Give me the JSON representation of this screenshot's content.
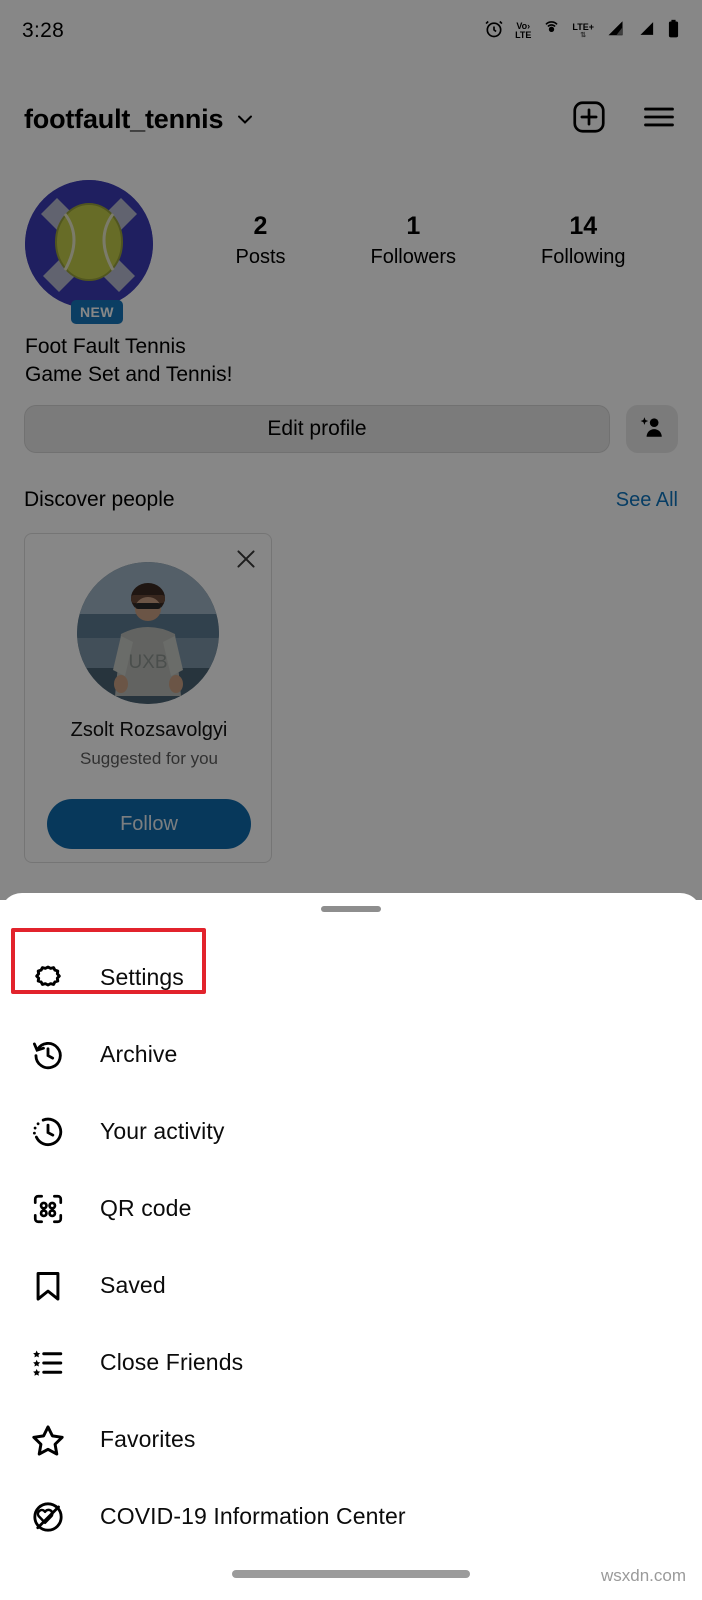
{
  "status_bar": {
    "time": "3:28",
    "icons": [
      {
        "name": "alarm-icon",
        "label": "alarm"
      },
      {
        "name": "volte-icon",
        "label": "VoLTE"
      },
      {
        "name": "hotspot-icon",
        "label": "hotspot"
      },
      {
        "name": "lte-plus-icon",
        "label": "LTE+"
      },
      {
        "name": "signal-sim1-icon",
        "label": "signal 1"
      },
      {
        "name": "signal-sim2-icon",
        "label": "signal 2"
      },
      {
        "name": "battery-icon",
        "label": "battery"
      }
    ]
  },
  "header": {
    "username": "footfault_tennis",
    "dropdown_icon": "chevron-down-icon",
    "create_icon": "plus-square-icon",
    "menu_icon": "hamburger-menu-icon"
  },
  "profile": {
    "avatar_badge": "NEW",
    "display_name": "Foot Fault Tennis",
    "bio": "Game Set and Tennis!",
    "stats": [
      {
        "value": "2",
        "label": "Posts"
      },
      {
        "value": "1",
        "label": "Followers"
      },
      {
        "value": "14",
        "label": "Following"
      }
    ],
    "edit_profile_label": "Edit profile",
    "add_person_icon": "add-person-icon"
  },
  "discover": {
    "title": "Discover people",
    "see_all_label": "See All",
    "suggestion": {
      "name": "Zsolt Rozsavolgyi",
      "subtitle": "Suggested for you",
      "follow_label": "Follow",
      "close_icon": "close-icon"
    }
  },
  "sheet": {
    "items": [
      {
        "label": "Settings",
        "icon": "gear-icon",
        "highlighted": true
      },
      {
        "label": "Archive",
        "icon": "archive-clock-icon",
        "highlighted": false
      },
      {
        "label": "Your activity",
        "icon": "activity-clock-icon",
        "highlighted": false
      },
      {
        "label": "QR code",
        "icon": "qr-code-icon",
        "highlighted": false
      },
      {
        "label": "Saved",
        "icon": "bookmark-icon",
        "highlighted": false
      },
      {
        "label": "Close Friends",
        "icon": "close-friends-list-icon",
        "highlighted": false
      },
      {
        "label": "Favorites",
        "icon": "star-icon",
        "highlighted": false
      },
      {
        "label": "COVID-19 Information Center",
        "icon": "covid-info-icon",
        "highlighted": false
      }
    ]
  },
  "colors": {
    "highlight": "#e2232c",
    "link": "#0f74bd",
    "follow_button": "#0f6bad",
    "badge": "#1675bb",
    "avatar_blue": "#3b3bb5",
    "tennis_yellow": "#c3cc4a"
  },
  "watermark": "wsxdn.com"
}
